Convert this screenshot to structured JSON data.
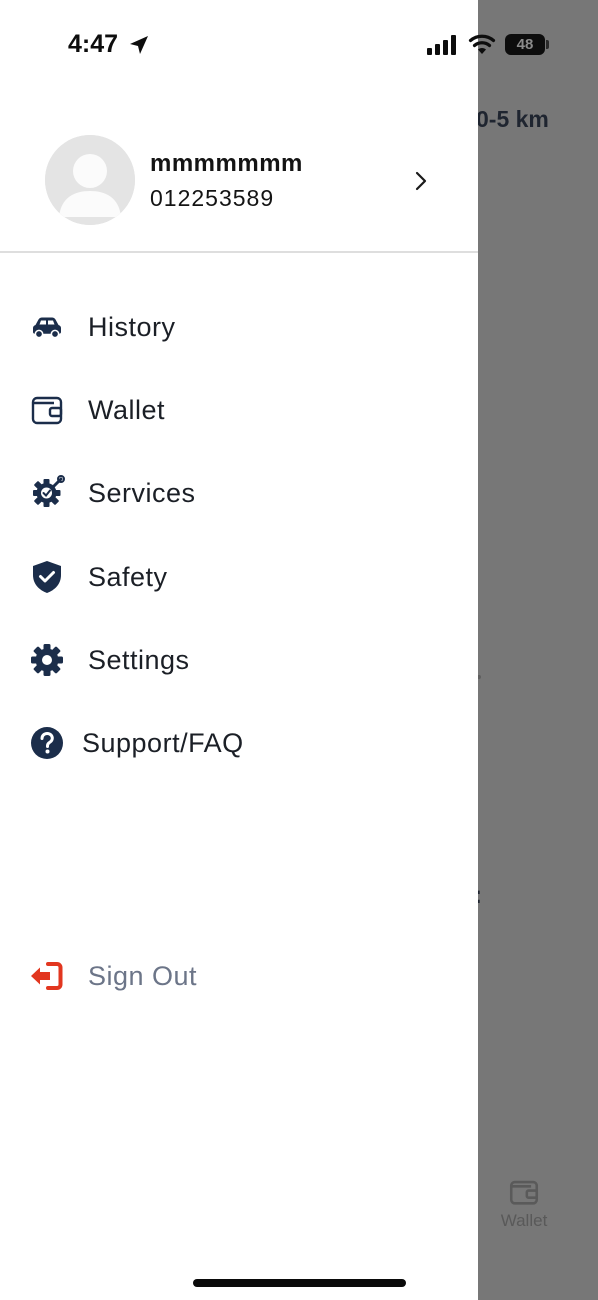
{
  "status_bar": {
    "time": "4:47",
    "battery": "48"
  },
  "background": {
    "distance_label": "0-5 km",
    "colon": ":",
    "tab_wallet_label": "Wallet"
  },
  "profile": {
    "name": "mmmmmmm",
    "phone": "012253589"
  },
  "menu": {
    "items": [
      {
        "label": "History",
        "icon": "car-icon"
      },
      {
        "label": "Wallet",
        "icon": "wallet-icon"
      },
      {
        "label": "Services",
        "icon": "services-gear-wrench-icon"
      },
      {
        "label": "Safety",
        "icon": "shield-check-icon"
      },
      {
        "label": "Settings",
        "icon": "gear-icon"
      },
      {
        "label": "Support/FAQ",
        "icon": "question-circle-icon"
      }
    ],
    "sign_out": {
      "label": "Sign Out",
      "icon": "sign-out-icon"
    }
  },
  "colors": {
    "icon_navy": "#1b2d4a",
    "sign_out_red": "#e2361f",
    "sign_out_text": "#6c7588",
    "overlay": "#777777"
  }
}
